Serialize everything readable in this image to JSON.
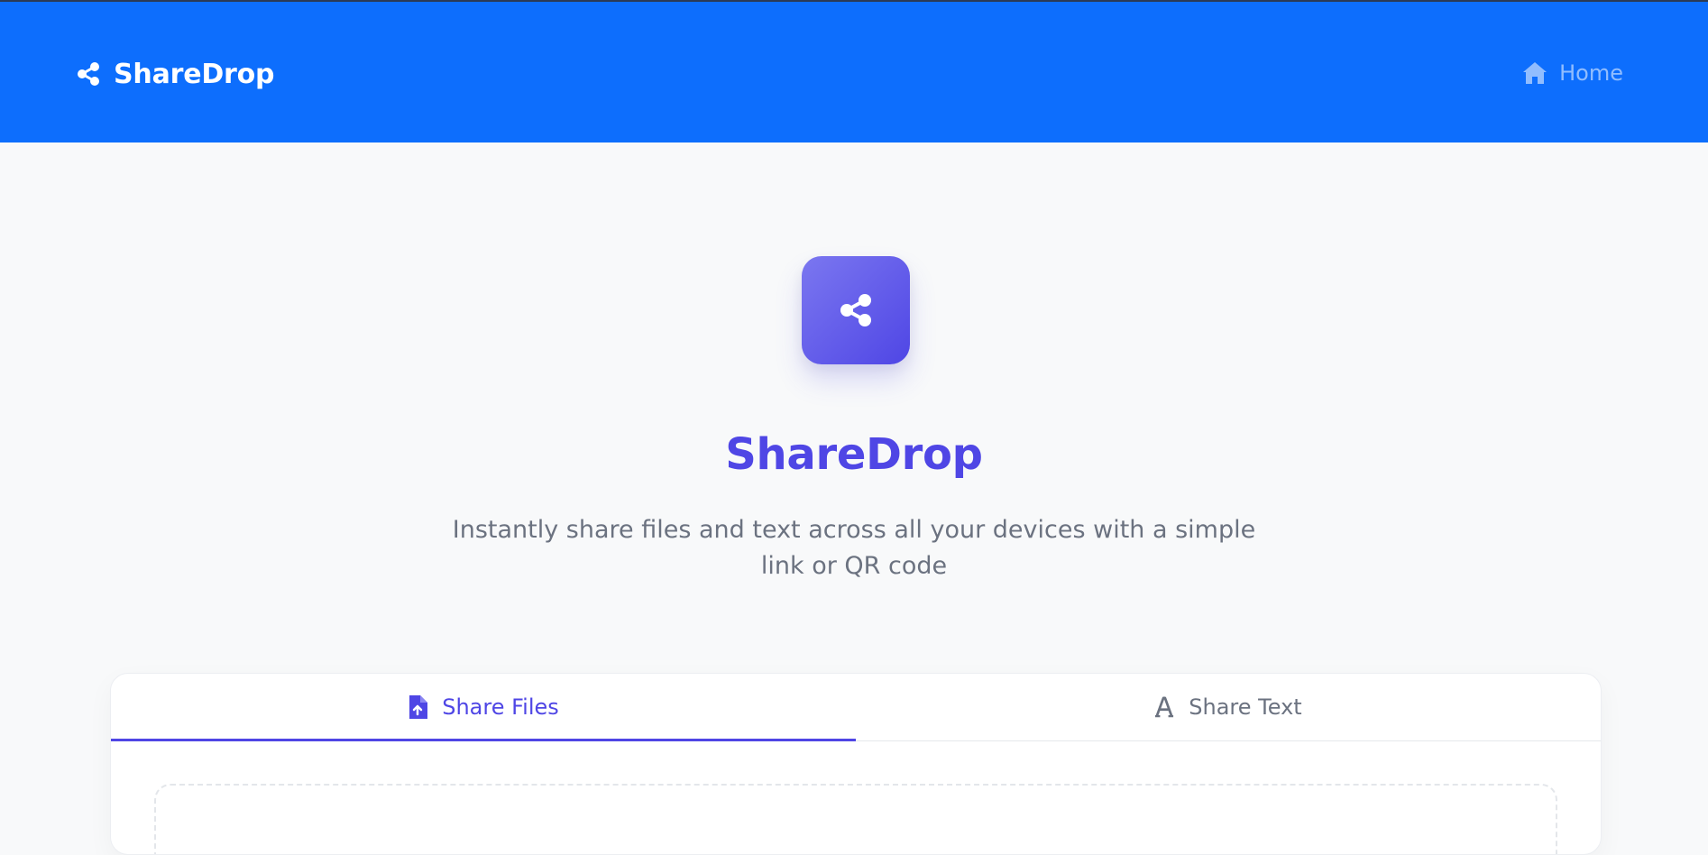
{
  "navbar": {
    "brand_icon": "share-icon",
    "brand": "ShareDrop",
    "home_icon": "home-icon",
    "home_label": "Home",
    "bg_color": "#0d6efd"
  },
  "hero": {
    "logo_icon": "share-icon",
    "title": "ShareDrop",
    "subtitle": "Instantly share files and text across all your devices with a simple link or QR code",
    "accent_color": "#4f46e5"
  },
  "tabs": [
    {
      "label": "Share Files",
      "icon": "file-upload-icon",
      "active": true
    },
    {
      "label": "Share Text",
      "icon": "text-font-icon",
      "active": false
    }
  ]
}
